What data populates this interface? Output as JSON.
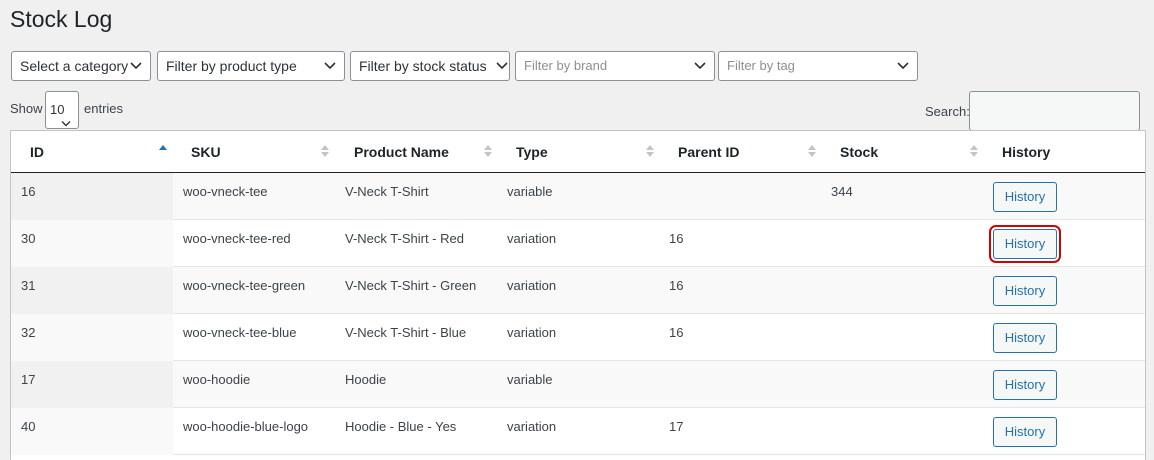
{
  "page": {
    "title": "Stock Log"
  },
  "filters": [
    {
      "label": "Select a category",
      "style": "normal"
    },
    {
      "label": "Filter by product type",
      "style": "normal"
    },
    {
      "label": "Filter by stock status",
      "style": "normal"
    },
    {
      "label": "Filter by brand",
      "style": "light"
    },
    {
      "label": "Filter by tag",
      "style": "light"
    }
  ],
  "length": {
    "show_label": "Show",
    "value": "10",
    "entries_label": "entries"
  },
  "search": {
    "label": "Search:",
    "value": ""
  },
  "table": {
    "columns": [
      "ID",
      "SKU",
      "Product Name",
      "Type",
      "Parent ID",
      "Stock",
      "History"
    ],
    "rows": [
      {
        "id": "16",
        "sku": "woo-vneck-tee",
        "name": "V-Neck T-Shirt",
        "type": "variable",
        "parent": "",
        "stock": "344",
        "history": "History"
      },
      {
        "id": "30",
        "sku": "woo-vneck-tee-red",
        "name": "V-Neck T-Shirt - Red",
        "type": "variation",
        "parent": "16",
        "stock": "",
        "history": "History"
      },
      {
        "id": "31",
        "sku": "woo-vneck-tee-green",
        "name": "V-Neck T-Shirt - Green",
        "type": "variation",
        "parent": "16",
        "stock": "",
        "history": "History"
      },
      {
        "id": "32",
        "sku": "woo-vneck-tee-blue",
        "name": "V-Neck T-Shirt - Blue",
        "type": "variation",
        "parent": "16",
        "stock": "",
        "history": "History"
      },
      {
        "id": "17",
        "sku": "woo-hoodie",
        "name": "Hoodie",
        "type": "variable",
        "parent": "",
        "stock": "",
        "history": "History"
      },
      {
        "id": "40",
        "sku": "woo-hoodie-blue-logo",
        "name": "Hoodie - Blue - Yes",
        "type": "variation",
        "parent": "17",
        "stock": "",
        "history": "History"
      }
    ]
  },
  "colors": {
    "accent": "#2271b1",
    "highlight": "#d40000"
  },
  "icons": {
    "dropdown": "chevron-down-icon",
    "sort": "sort-icon"
  }
}
